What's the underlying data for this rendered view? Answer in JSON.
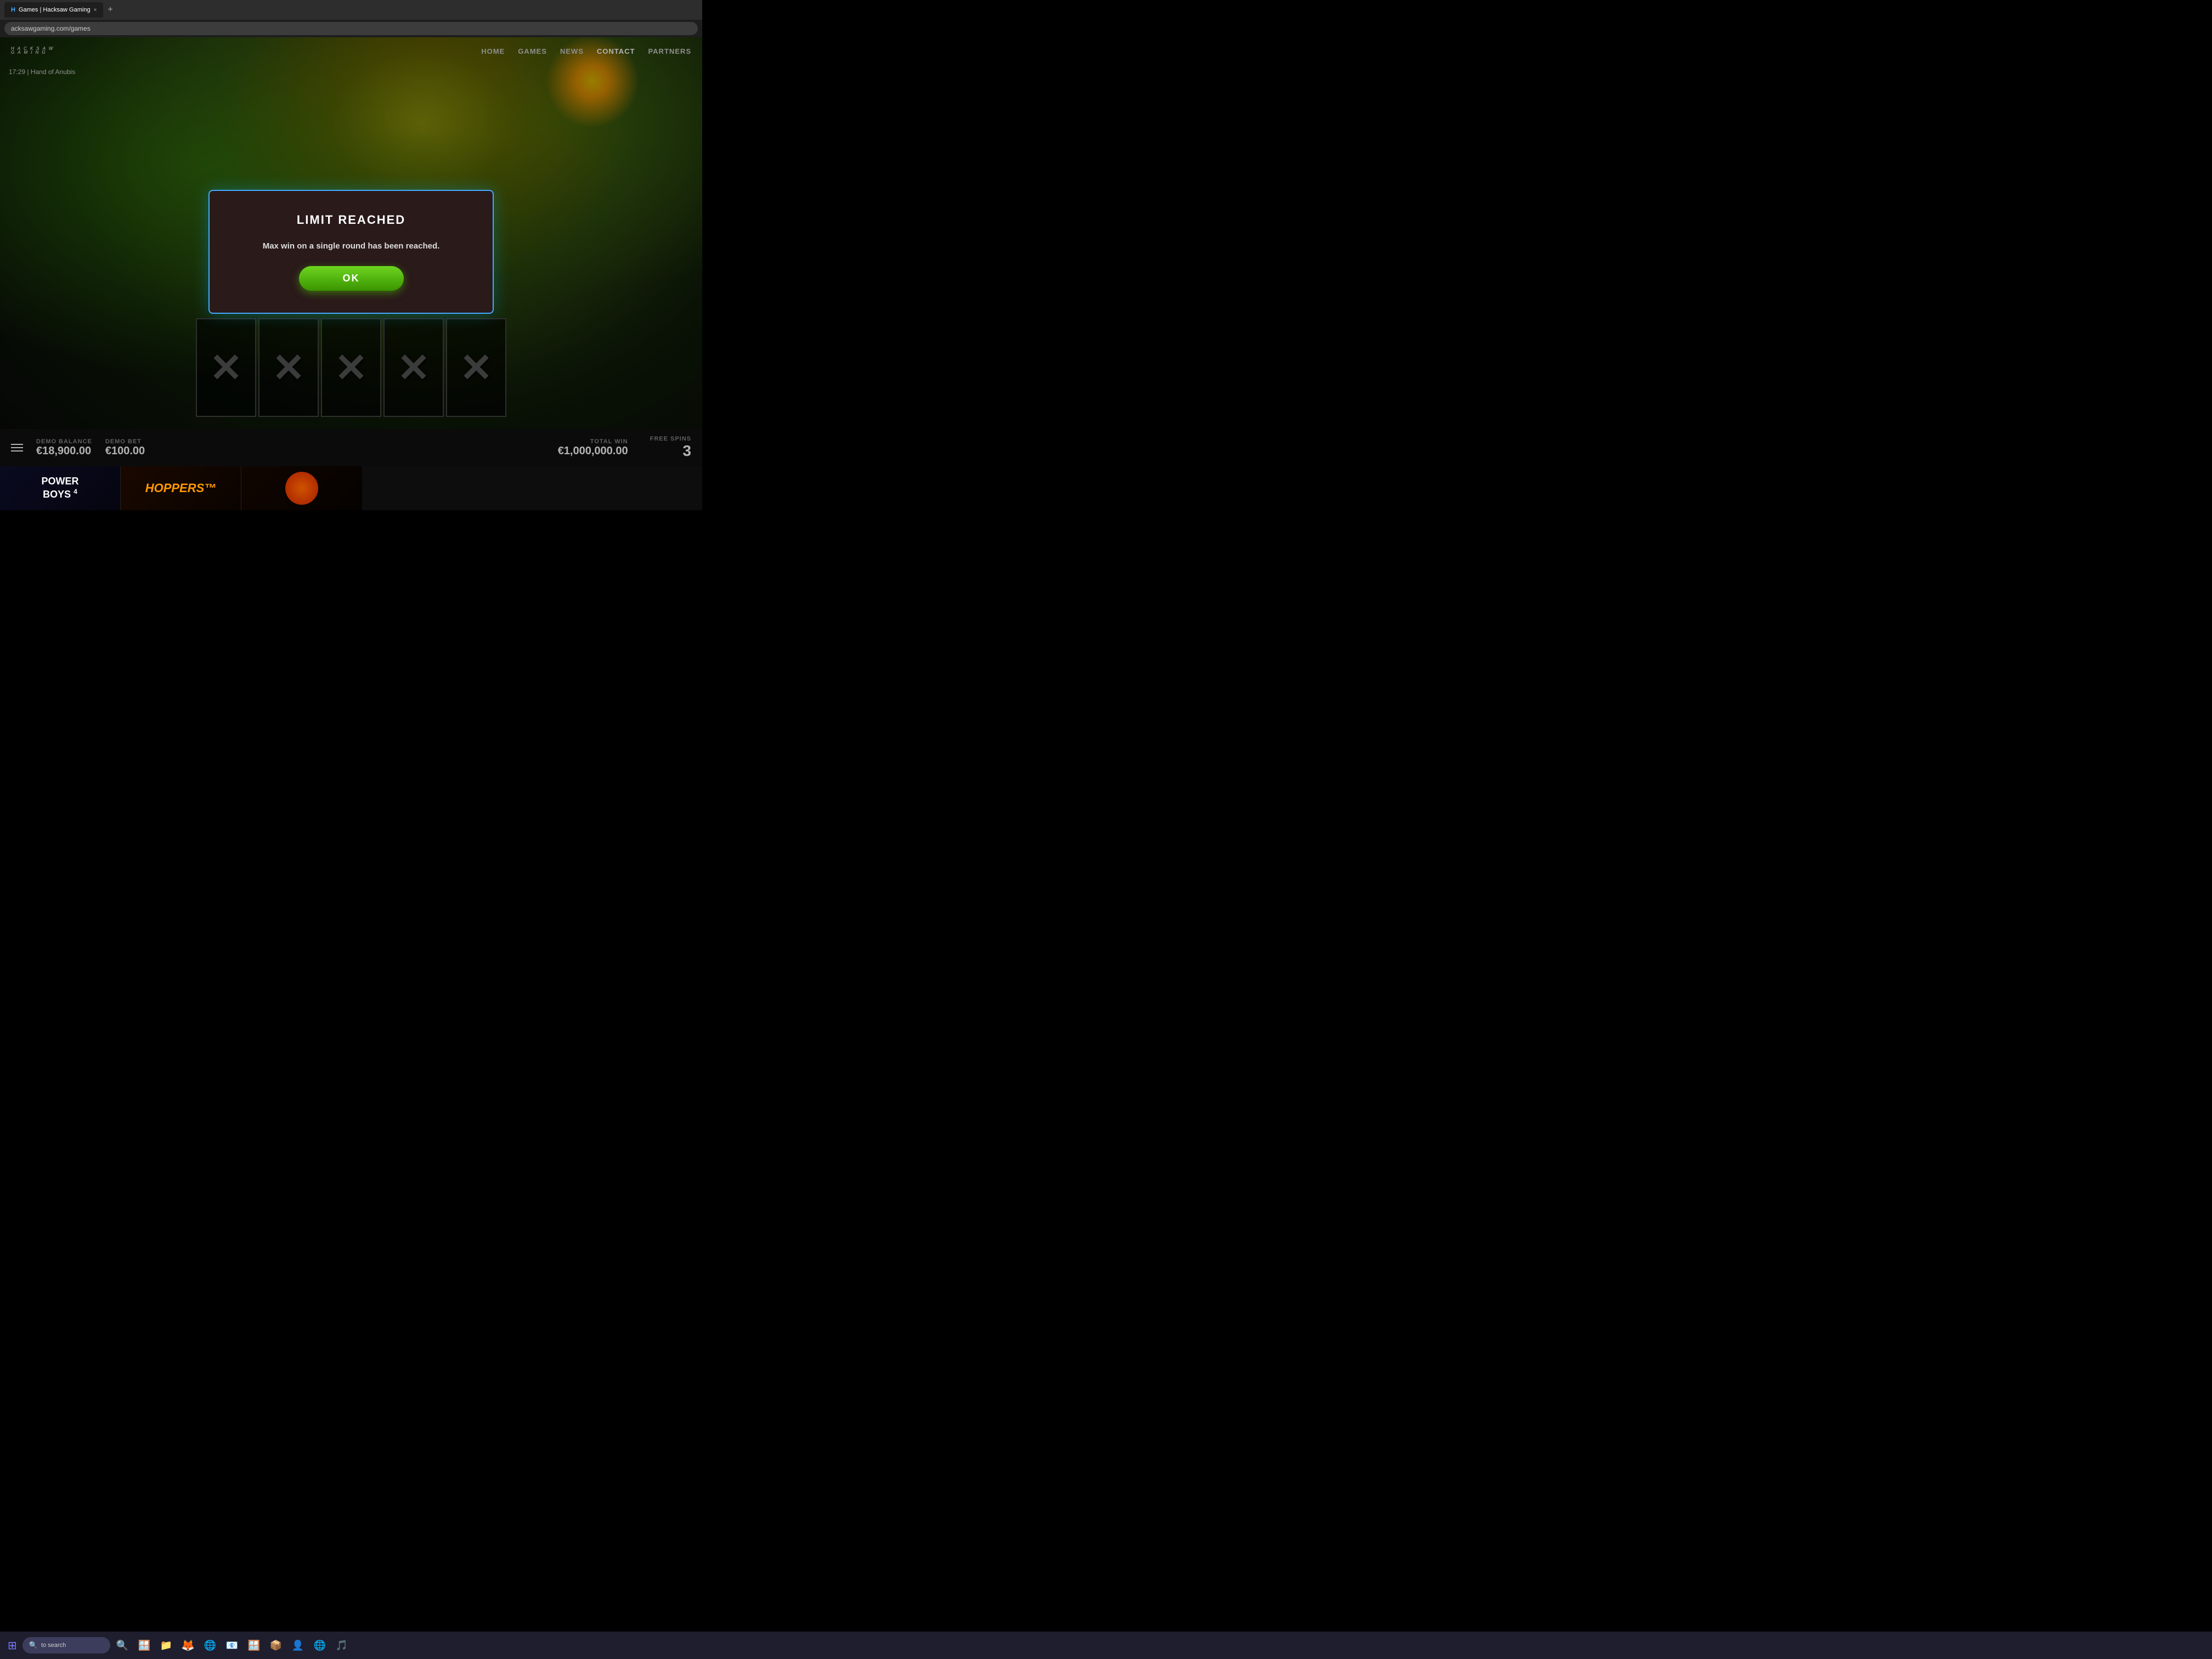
{
  "browser": {
    "tab_favicon": "H",
    "tab_label": "Games | Hacksaw Gaming",
    "tab_close": "×",
    "new_tab": "+",
    "address": "acksawgaming.com/games"
  },
  "nav": {
    "logo_main": "HACKSAW",
    "logo_sub": "GAMING",
    "links": [
      {
        "id": "home",
        "label": "HOME"
      },
      {
        "id": "games",
        "label": "GAMES"
      },
      {
        "id": "news",
        "label": "NEWS"
      },
      {
        "id": "contact",
        "label": "CONTACT"
      },
      {
        "id": "partners",
        "label": "PARTNERS"
      }
    ]
  },
  "game": {
    "timestamp": "17:29",
    "game_name": "Hand of Anubis"
  },
  "modal": {
    "title": "LIMIT REACHED",
    "message": "Max win on a single round has been reached.",
    "ok_label": "OK"
  },
  "hud": {
    "menu_label": "menu",
    "demo_balance_label": "DEMO BALANCE",
    "demo_balance_value": "€18,900.00",
    "demo_bet_label": "DEMO BET",
    "demo_bet_value": "€100.00",
    "total_win_label": "TOTAL WIN",
    "total_win_value": "€1,000,000.00",
    "free_spins_label": "FREE SPINS",
    "free_spins_value": "3"
  },
  "carousel": {
    "items": [
      {
        "id": "power-boys",
        "label": "POWER\nBOYS",
        "sub": "4"
      },
      {
        "id": "hoppers",
        "label": "HOPPERS™"
      },
      {
        "id": "game3",
        "label": ""
      }
    ]
  },
  "taskbar": {
    "search_placeholder": "to search",
    "icons": [
      "🔍",
      "🪟",
      "📁",
      "🦊",
      "🌐",
      "📧",
      "🪟",
      "📦",
      "👤",
      "🎵"
    ]
  }
}
